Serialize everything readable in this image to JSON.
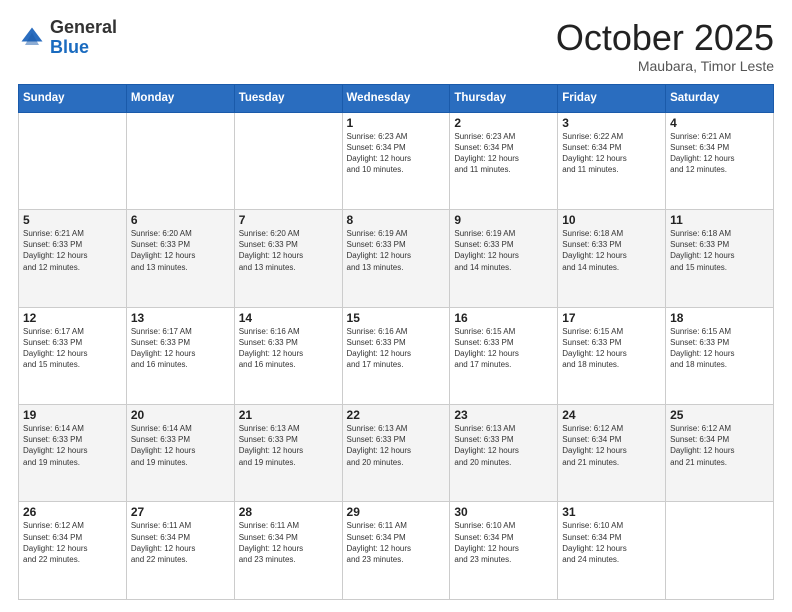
{
  "logo": {
    "general": "General",
    "blue": "Blue"
  },
  "header": {
    "month": "October 2025",
    "location": "Maubara, Timor Leste"
  },
  "weekdays": [
    "Sunday",
    "Monday",
    "Tuesday",
    "Wednesday",
    "Thursday",
    "Friday",
    "Saturday"
  ],
  "weeks": [
    [
      {
        "day": "",
        "info": ""
      },
      {
        "day": "",
        "info": ""
      },
      {
        "day": "",
        "info": ""
      },
      {
        "day": "1",
        "info": "Sunrise: 6:23 AM\nSunset: 6:34 PM\nDaylight: 12 hours\nand 10 minutes."
      },
      {
        "day": "2",
        "info": "Sunrise: 6:23 AM\nSunset: 6:34 PM\nDaylight: 12 hours\nand 11 minutes."
      },
      {
        "day": "3",
        "info": "Sunrise: 6:22 AM\nSunset: 6:34 PM\nDaylight: 12 hours\nand 11 minutes."
      },
      {
        "day": "4",
        "info": "Sunrise: 6:21 AM\nSunset: 6:34 PM\nDaylight: 12 hours\nand 12 minutes."
      }
    ],
    [
      {
        "day": "5",
        "info": "Sunrise: 6:21 AM\nSunset: 6:33 PM\nDaylight: 12 hours\nand 12 minutes."
      },
      {
        "day": "6",
        "info": "Sunrise: 6:20 AM\nSunset: 6:33 PM\nDaylight: 12 hours\nand 13 minutes."
      },
      {
        "day": "7",
        "info": "Sunrise: 6:20 AM\nSunset: 6:33 PM\nDaylight: 12 hours\nand 13 minutes."
      },
      {
        "day": "8",
        "info": "Sunrise: 6:19 AM\nSunset: 6:33 PM\nDaylight: 12 hours\nand 13 minutes."
      },
      {
        "day": "9",
        "info": "Sunrise: 6:19 AM\nSunset: 6:33 PM\nDaylight: 12 hours\nand 14 minutes."
      },
      {
        "day": "10",
        "info": "Sunrise: 6:18 AM\nSunset: 6:33 PM\nDaylight: 12 hours\nand 14 minutes."
      },
      {
        "day": "11",
        "info": "Sunrise: 6:18 AM\nSunset: 6:33 PM\nDaylight: 12 hours\nand 15 minutes."
      }
    ],
    [
      {
        "day": "12",
        "info": "Sunrise: 6:17 AM\nSunset: 6:33 PM\nDaylight: 12 hours\nand 15 minutes."
      },
      {
        "day": "13",
        "info": "Sunrise: 6:17 AM\nSunset: 6:33 PM\nDaylight: 12 hours\nand 16 minutes."
      },
      {
        "day": "14",
        "info": "Sunrise: 6:16 AM\nSunset: 6:33 PM\nDaylight: 12 hours\nand 16 minutes."
      },
      {
        "day": "15",
        "info": "Sunrise: 6:16 AM\nSunset: 6:33 PM\nDaylight: 12 hours\nand 17 minutes."
      },
      {
        "day": "16",
        "info": "Sunrise: 6:15 AM\nSunset: 6:33 PM\nDaylight: 12 hours\nand 17 minutes."
      },
      {
        "day": "17",
        "info": "Sunrise: 6:15 AM\nSunset: 6:33 PM\nDaylight: 12 hours\nand 18 minutes."
      },
      {
        "day": "18",
        "info": "Sunrise: 6:15 AM\nSunset: 6:33 PM\nDaylight: 12 hours\nand 18 minutes."
      }
    ],
    [
      {
        "day": "19",
        "info": "Sunrise: 6:14 AM\nSunset: 6:33 PM\nDaylight: 12 hours\nand 19 minutes."
      },
      {
        "day": "20",
        "info": "Sunrise: 6:14 AM\nSunset: 6:33 PM\nDaylight: 12 hours\nand 19 minutes."
      },
      {
        "day": "21",
        "info": "Sunrise: 6:13 AM\nSunset: 6:33 PM\nDaylight: 12 hours\nand 19 minutes."
      },
      {
        "day": "22",
        "info": "Sunrise: 6:13 AM\nSunset: 6:33 PM\nDaylight: 12 hours\nand 20 minutes."
      },
      {
        "day": "23",
        "info": "Sunrise: 6:13 AM\nSunset: 6:33 PM\nDaylight: 12 hours\nand 20 minutes."
      },
      {
        "day": "24",
        "info": "Sunrise: 6:12 AM\nSunset: 6:34 PM\nDaylight: 12 hours\nand 21 minutes."
      },
      {
        "day": "25",
        "info": "Sunrise: 6:12 AM\nSunset: 6:34 PM\nDaylight: 12 hours\nand 21 minutes."
      }
    ],
    [
      {
        "day": "26",
        "info": "Sunrise: 6:12 AM\nSunset: 6:34 PM\nDaylight: 12 hours\nand 22 minutes."
      },
      {
        "day": "27",
        "info": "Sunrise: 6:11 AM\nSunset: 6:34 PM\nDaylight: 12 hours\nand 22 minutes."
      },
      {
        "day": "28",
        "info": "Sunrise: 6:11 AM\nSunset: 6:34 PM\nDaylight: 12 hours\nand 23 minutes."
      },
      {
        "day": "29",
        "info": "Sunrise: 6:11 AM\nSunset: 6:34 PM\nDaylight: 12 hours\nand 23 minutes."
      },
      {
        "day": "30",
        "info": "Sunrise: 6:10 AM\nSunset: 6:34 PM\nDaylight: 12 hours\nand 23 minutes."
      },
      {
        "day": "31",
        "info": "Sunrise: 6:10 AM\nSunset: 6:34 PM\nDaylight: 12 hours\nand 24 minutes."
      },
      {
        "day": "",
        "info": ""
      }
    ]
  ]
}
